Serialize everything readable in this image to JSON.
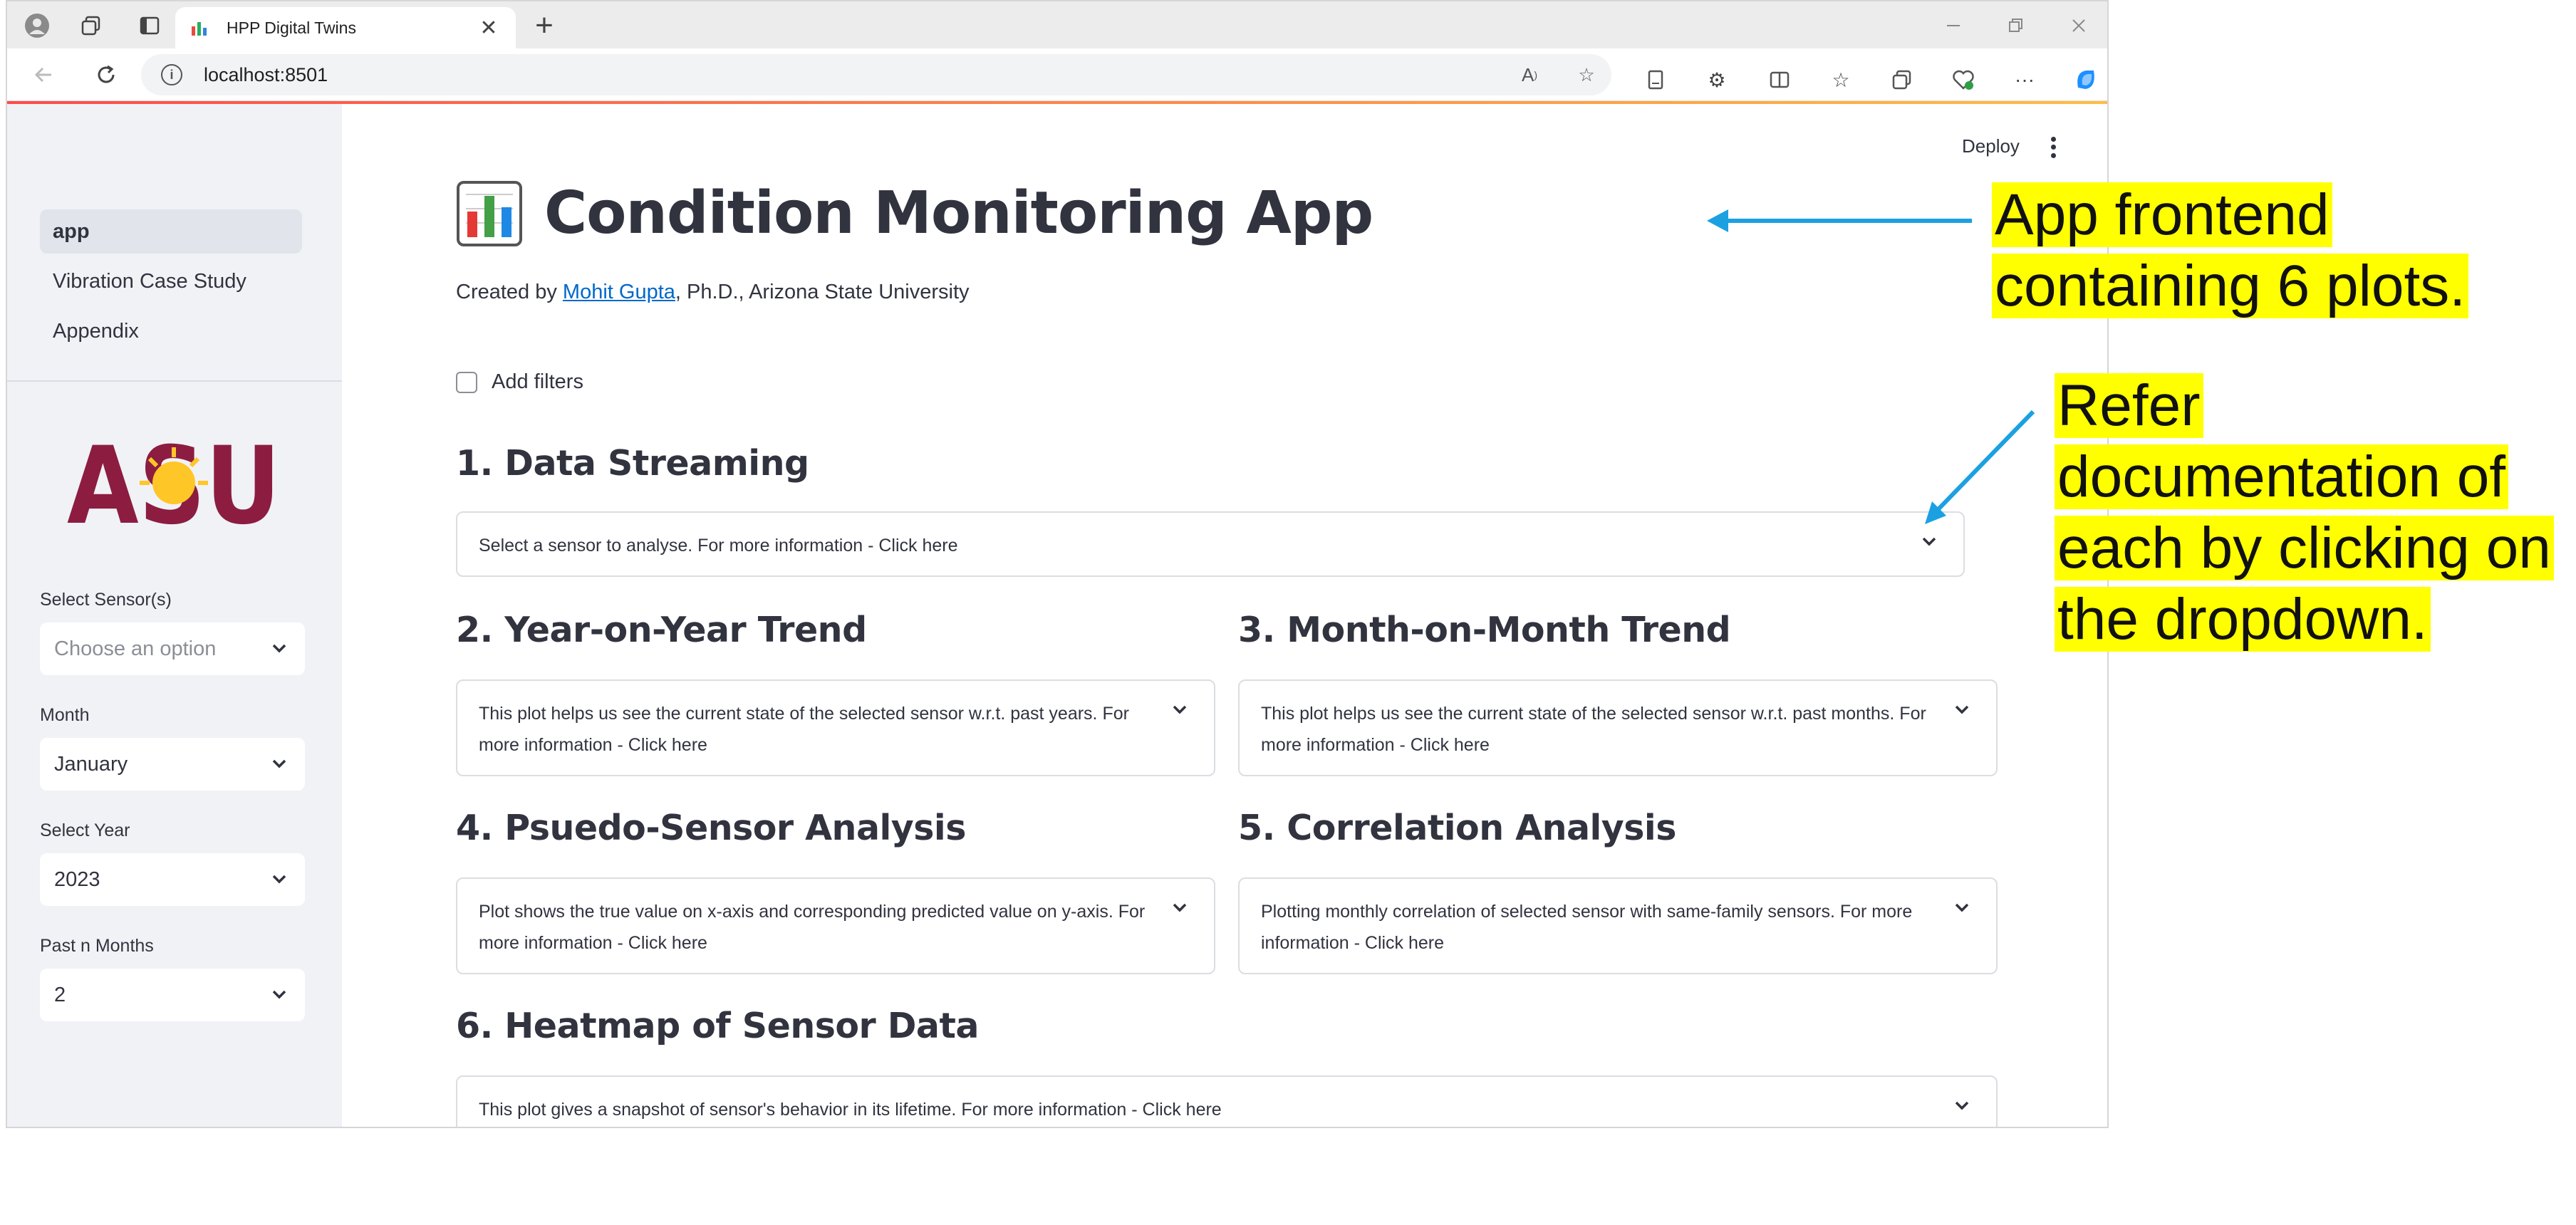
{
  "browser": {
    "tab_title": "HPP Digital Twins",
    "url": "localhost:8501"
  },
  "header": {
    "deploy_label": "Deploy"
  },
  "sidebar": {
    "nav": [
      {
        "label": "app",
        "active": true
      },
      {
        "label": "Vibration Case Study",
        "active": false
      },
      {
        "label": "Appendix",
        "active": false
      }
    ],
    "logo_text": "ASU",
    "sensor_label": "Select Sensor(s)",
    "sensor_placeholder": "Choose an option",
    "month_label": "Month",
    "month_value": "January",
    "year_label": "Select Year",
    "year_value": "2023",
    "past_label": "Past n Months",
    "past_value": "2"
  },
  "main": {
    "title": "Condition Monitoring App",
    "created_prefix": "Created by ",
    "author": "Mohit Gupta",
    "created_suffix": ", Ph.D., Arizona State University",
    "filters_label": "Add filters",
    "sections": [
      {
        "heading": "1. Data Streaming",
        "text": "Select a sensor to analyse. For more information - Click here"
      },
      {
        "heading": "2. Year-on-Year Trend",
        "text": "This plot helps us see the current state of the selected sensor w.r.t. past years. For more information - Click here"
      },
      {
        "heading": "3. Month-on-Month Trend",
        "text": "This plot helps us see the current state of the selected sensor w.r.t. past months. For more information - Click here"
      },
      {
        "heading": "4. Psuedo-Sensor Analysis",
        "text": "Plot shows the true value on x-axis and corresponding predicted value on y-axis. For more information - Click here"
      },
      {
        "heading": "5. Correlation Analysis",
        "text": "Plotting monthly correlation of selected sensor with same-family sensors. For more information - Click here"
      },
      {
        "heading": "6. Heatmap of Sensor Data",
        "text": "This plot gives a snapshot of sensor's behavior in its lifetime. For more information - Click here"
      }
    ]
  },
  "annotations": {
    "note1": "App frontend containing 6 plots.",
    "note2": "Refer documentation of each by clicking on the dropdown.",
    "arrow_color": "#1ba1e2",
    "highlight_color": "#ffff00"
  },
  "colors": {
    "accent": "#ff4b4b",
    "link": "#0068c9",
    "sidebar_bg": "#f0f2f6",
    "asu_maroon": "#8c1d40",
    "asu_gold": "#ffc627"
  }
}
